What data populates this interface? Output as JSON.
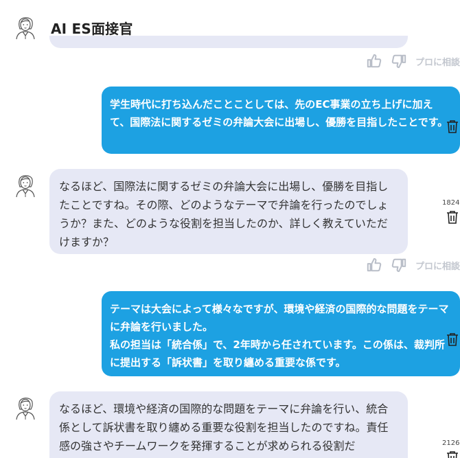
{
  "header": {
    "title": "AI ES面接官"
  },
  "feedback": {
    "pro_label": "プロに相談"
  },
  "messages": [
    {
      "role": "user",
      "text": "学生時代に打ち込んだことことしては、先のEC事業の立ち上げに加えて、国際法に関するゼミの弁論大会に出場し、優勝を目指したことです。"
    },
    {
      "role": "ai",
      "text": "なるほど、国際法に関するゼミの弁論大会に出場し、優勝を目指したことですね。その際、どのようなテーマで弁論を行ったのでしょうか？また、どのような役割を担当したのか、詳しく教えていただけますか？",
      "count": "1824"
    },
    {
      "role": "user",
      "line1": "テーマは大会によって様々なですが、環境や経済の国際的な問題をテーマに弁論を行いました。",
      "line2": "私の担当は「統合係」で、2年時から任されています。この係は、裁判所に提出する「訴状書」を取り纏める重要な係です。"
    },
    {
      "role": "ai",
      "text": "なるほど、環境や経済の国際的な問題をテーマに弁論を行い、統合係として訴状書を取り纏める重要な役割を担当したのですね。責任感の強さやチームワークを発揮することが求められる役割だ",
      "count": "2126"
    }
  ]
}
